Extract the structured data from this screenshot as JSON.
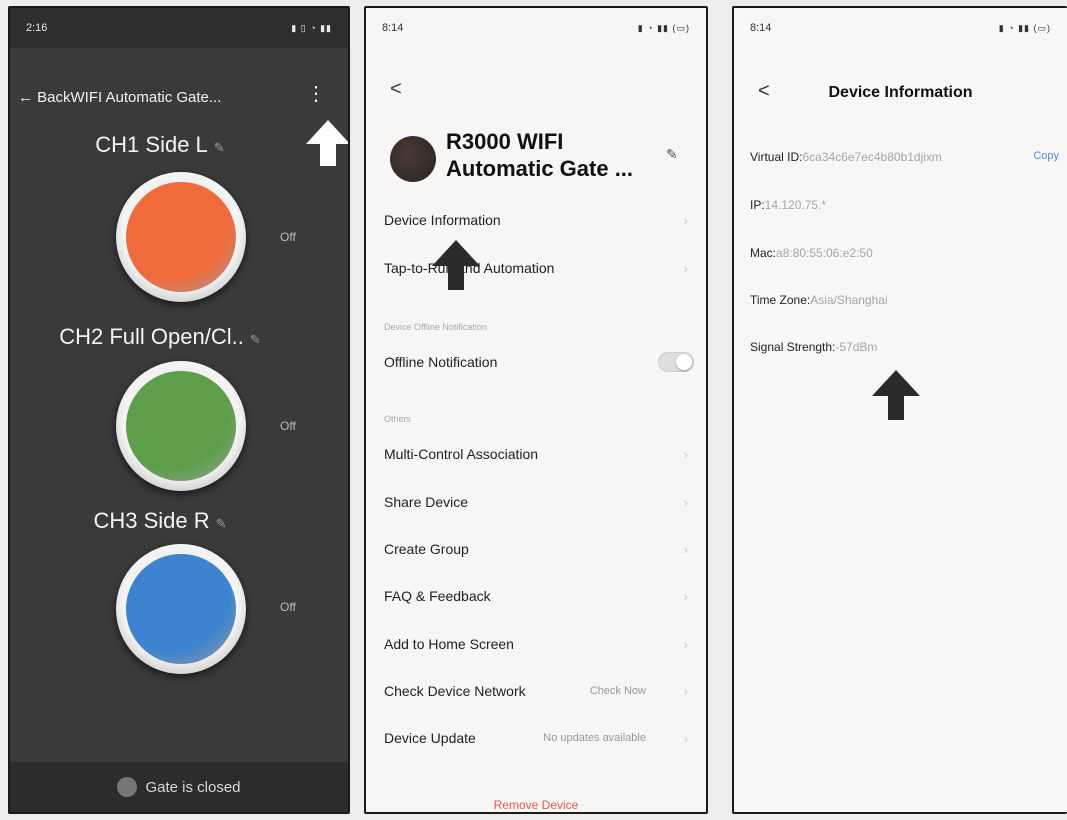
{
  "colors": {
    "ch1": "#f06a3c",
    "ch2": "#5c9e49",
    "ch3": "#3d83cf",
    "arrow_white": "#ffffff",
    "arrow_dark": "#2b2b2b",
    "remove": "#e05a50",
    "link": "#4a8fd8"
  },
  "control_screen": {
    "status_time": "2:16",
    "header_title": "← BackWIFI Automatic Gate...",
    "more_icon": "vertical-dots-icon",
    "channels": [
      {
        "label": "CH1 Side L",
        "state": "Off",
        "color_key": "ch1"
      },
      {
        "label": "CH2 Full Open/Cl..",
        "state": "Off",
        "color_key": "ch2"
      },
      {
        "label": "CH3 Side R",
        "state": "Off",
        "color_key": "ch3"
      }
    ],
    "gate_status": "Gate is closed"
  },
  "settings_screen": {
    "status_time": "8:14",
    "back": "<",
    "device_name_line1": "R3000 WIFI",
    "device_name_line2": "Automatic Gate ...",
    "items": {
      "device_information": "Device Information",
      "tap_to_run": "Tap-to-Run and Automation",
      "offline_section": "Device Offline Notification",
      "offline_notification": "Offline Notification",
      "others_section": "Others",
      "multi_control": "Multi-Control Association",
      "share_device": "Share Device",
      "create_group": "Create Group",
      "faq": "FAQ & Feedback",
      "add_home": "Add to Home Screen",
      "check_network": "Check Device Network",
      "check_now": "Check Now",
      "device_update": "Device Update",
      "no_updates": "No updates available"
    },
    "offline_notification_enabled": false,
    "remove_device": "Remove Device"
  },
  "info_screen": {
    "status_time": "8:14",
    "back": "<",
    "title": "Device Information",
    "virtual_id_label": "Virtual ID:",
    "virtual_id_value": "6ca34c6e7ec4b80b1djixm",
    "copy_label": "Copy",
    "ip_label": "IP:",
    "ip_value": "14.120.75.*",
    "mac_label": "Mac:",
    "mac_value": "a8:80:55:06:e2:50",
    "timezone_label": "Time Zone:",
    "timezone_value": "Asia/Shanghai",
    "signal_label": "Signal Strength:",
    "signal_value": "-57dBm"
  }
}
